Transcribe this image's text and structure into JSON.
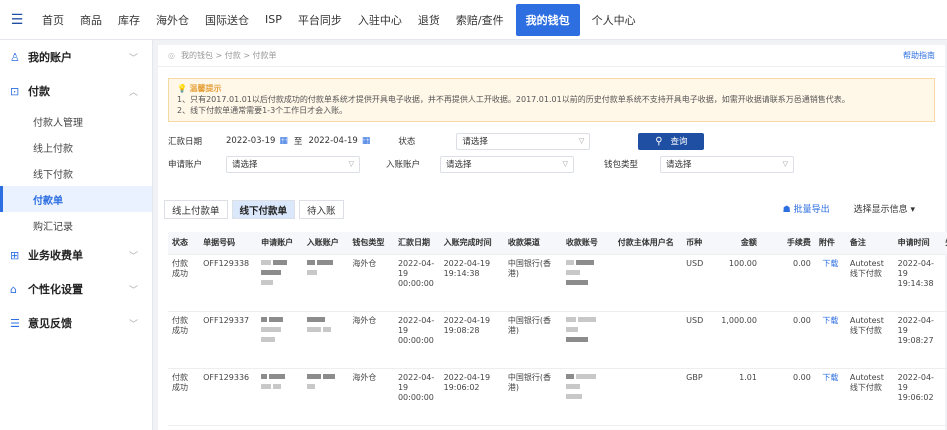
{
  "nav": {
    "items": [
      "首页",
      "商品",
      "库存",
      "海外仓",
      "国际送仓",
      "ISP",
      "平台同步",
      "入驻中心",
      "退货",
      "索赔/查件",
      "我的钱包",
      "个人中心"
    ],
    "active_index": 10
  },
  "sidebar": {
    "groups": [
      {
        "label": "我的账户",
        "icon": "user-icon"
      },
      {
        "label": "付款",
        "icon": "chart-icon",
        "items": [
          "付款人管理",
          "线上付款",
          "线下付款",
          "付款单",
          "购汇记录"
        ],
        "active_item": 3
      },
      {
        "label": "业务收费单",
        "icon": "plus-square-icon"
      },
      {
        "label": "个性化设置",
        "icon": "home-icon"
      },
      {
        "label": "意见反馈",
        "icon": "list-icon"
      }
    ]
  },
  "breadcrumb": {
    "text": "我的钱包 > 付款 > 付款单",
    "help": "帮助指南"
  },
  "tips": {
    "title": "温馨提示",
    "line1": "1、只有2017.01.01以后付款成功的付款单系统才提供开具电子收据，并不再提供人工开收据。2017.01.01以前的历史付款单系统不支持开具电子收据，如需开收据请联系万邑通销售代表。",
    "line2": "2、线下付款单通常需要1-3个工作日才会入账。"
  },
  "filters": {
    "date_label": "汇款日期",
    "date_from": "2022-03-19",
    "to": "至",
    "date_to": "2022-04-19",
    "status_label": "状态",
    "status_value": "请选择",
    "query": "查询",
    "apply_label": "申请账户",
    "apply_value": "请选择",
    "in_label": "入账账户",
    "in_value": "请选择",
    "wallet_label": "钱包类型",
    "wallet_value": "请选择"
  },
  "tabs": [
    "线上付款单",
    "线下付款单",
    "待入账"
  ],
  "active_tab": 1,
  "toolbar": {
    "export": "批量导出",
    "display": "选择显示信息"
  },
  "table": {
    "headers": [
      "状态",
      "单据号码",
      "申请账户",
      "入账账户",
      "钱包类型",
      "汇款日期",
      "入账完成时间",
      "收款渠道",
      "收款账号",
      "付款主体用户名",
      "币种",
      "金额",
      "手续费",
      "附件",
      "备注",
      "申请时间",
      "失"
    ],
    "rows": [
      {
        "status": "付款成功",
        "no": "OFF129338",
        "wallet": "海外仓",
        "date": "2022-04-19 00:00:00",
        "done": "2022-04-19 19:14:38",
        "channel": "中国银行(香港)",
        "currency": "USD",
        "amount": "100.00",
        "fee": "0.00",
        "attach": "下载",
        "remark": "Autotest线下付款",
        "apply_time": "2022-04-19 19:14:38"
      },
      {
        "status": "付款成功",
        "no": "OFF129337",
        "wallet": "海外仓",
        "date": "2022-04-19 00:00:00",
        "done": "2022-04-19 19:08:28",
        "channel": "中国银行(香港)",
        "currency": "USD",
        "amount": "1,000.00",
        "fee": "0.00",
        "attach": "下载",
        "remark": "Autotest线下付款",
        "apply_time": "2022-04-19 19:08:27"
      },
      {
        "status": "付款成功",
        "no": "OFF129336",
        "wallet": "海外仓",
        "date": "2022-04-19 00:00:00",
        "done": "2022-04-19 19:06:02",
        "channel": "中国银行(香港)",
        "currency": "GBP",
        "amount": "1.01",
        "fee": "0.00",
        "attach": "下载",
        "remark": "Autotest线下付款",
        "apply_time": "2022-04-19 19:06:02"
      }
    ]
  }
}
